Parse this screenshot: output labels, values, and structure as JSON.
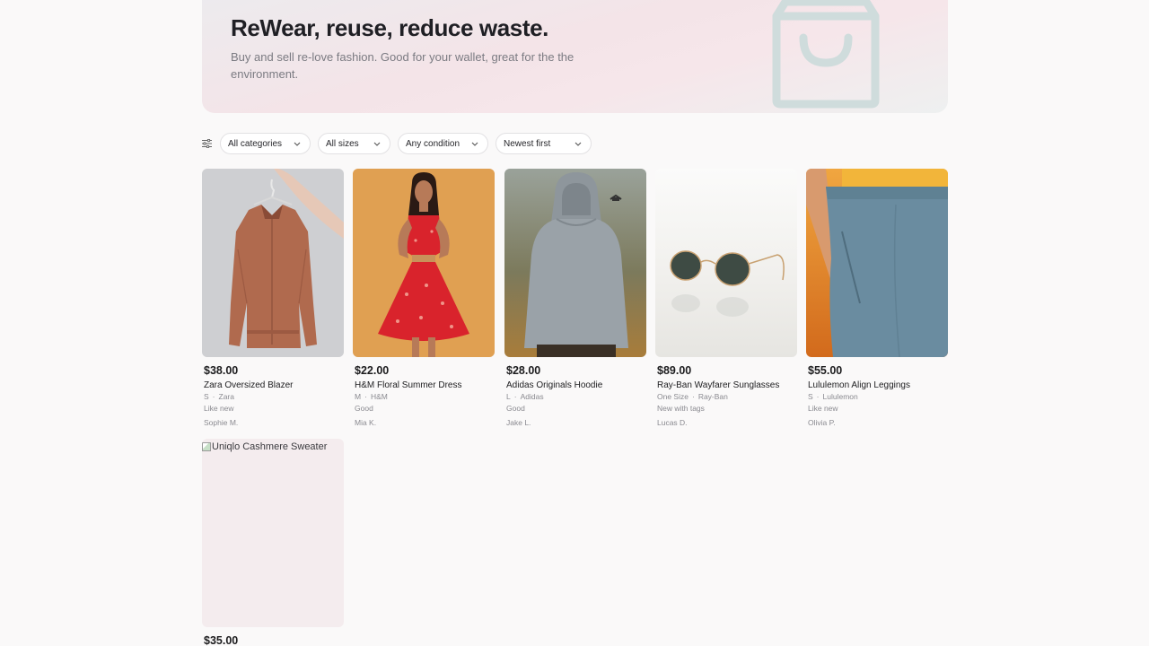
{
  "hero": {
    "title": "ReWear, reuse, reduce waste.",
    "subtitle": "Buy and sell re-love fashion. Good for your wallet, great for the the environment.",
    "icon": "shopping-bag-icon"
  },
  "filters": {
    "icon": "sliders-icon",
    "category": "All categories",
    "size": "All sizes",
    "condition": "Any condition",
    "sort": "Newest first"
  },
  "products": [
    {
      "price": "$38.00",
      "title": "Zara Oversized Blazer",
      "size": "S",
      "brand": "Zara",
      "condition": "Like new",
      "seller": "Sophie M."
    },
    {
      "price": "$22.00",
      "title": "H&M Floral Summer Dress",
      "size": "M",
      "brand": "H&M",
      "condition": "Good",
      "seller": "Mia K."
    },
    {
      "price": "$28.00",
      "title": "Adidas Originals Hoodie",
      "size": "L",
      "brand": "Adidas",
      "condition": "Good",
      "seller": "Jake L."
    },
    {
      "price": "$89.00",
      "title": "Ray-Ban Wayfarer Sunglasses",
      "size": "One Size",
      "brand": "Ray-Ban",
      "condition": "New with tags",
      "seller": "Lucas D."
    },
    {
      "price": "$55.00",
      "title": "Lululemon Align Leggings",
      "size": "S",
      "brand": "Lululemon",
      "condition": "Like new",
      "seller": "Olivia P."
    },
    {
      "price": "$35.00",
      "image_alt": "Uniqlo Cashmere Sweater"
    }
  ],
  "separator": "·"
}
